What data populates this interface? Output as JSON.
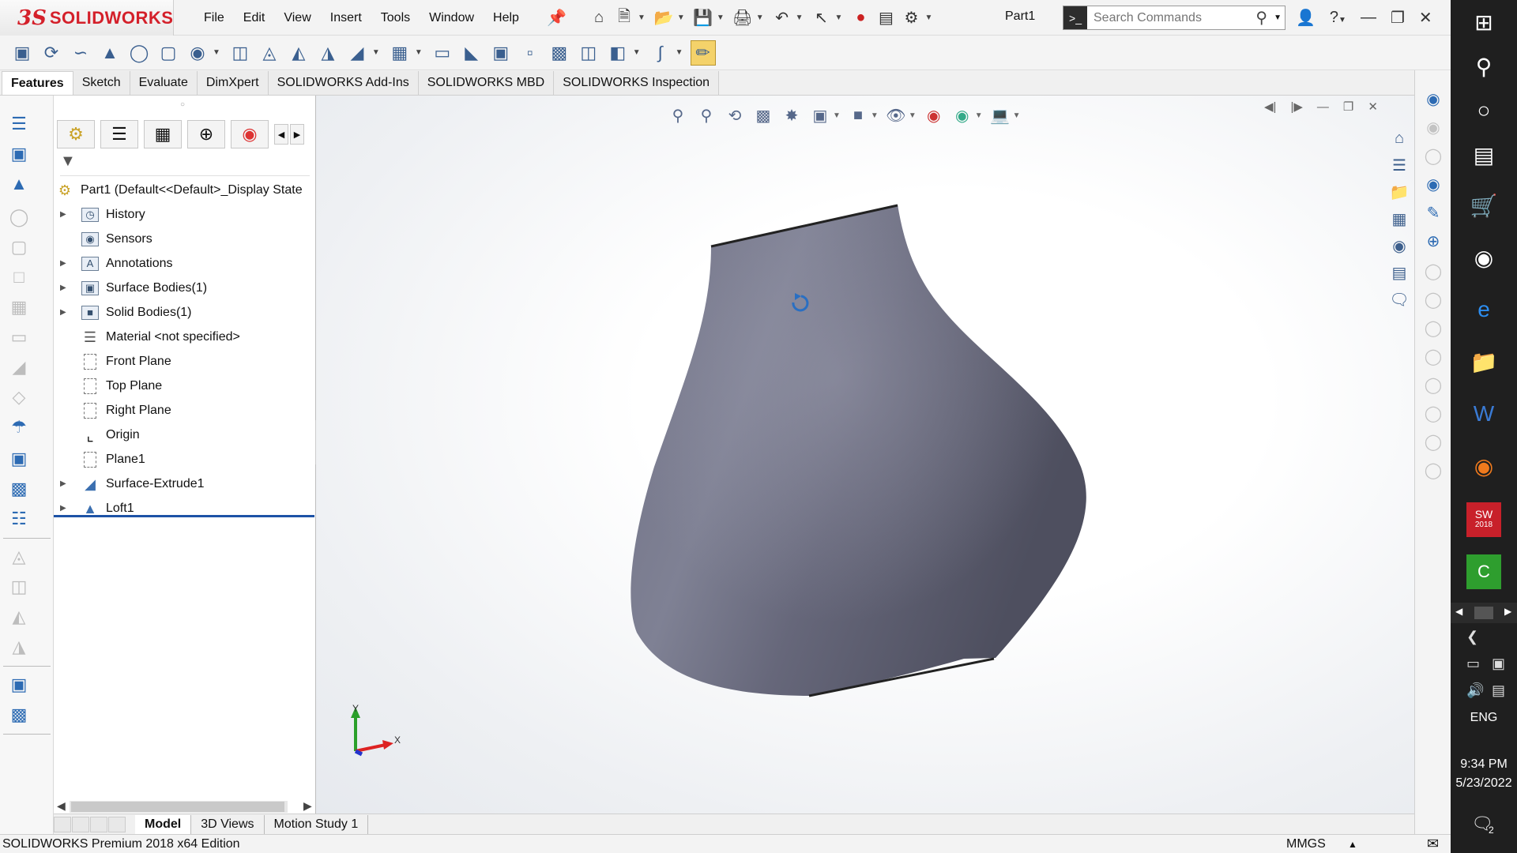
{
  "app": {
    "brand_prefix": "3S",
    "brand": "SOLIDWORKS",
    "document_title": "Part1",
    "menus": [
      "File",
      "Edit",
      "View",
      "Insert",
      "Tools",
      "Window",
      "Help"
    ],
    "search_placeholder": "Search Commands"
  },
  "tabs": [
    "Features",
    "Sketch",
    "Evaluate",
    "DimXpert",
    "SOLIDWORKS Add-Ins",
    "SOLIDWORKS MBD",
    "SOLIDWORKS Inspection"
  ],
  "active_tab": "Features",
  "feature_tree": {
    "root": "Part1  (Default<<Default>_Display State",
    "items": [
      {
        "label": "History",
        "expandable": true
      },
      {
        "label": "Sensors",
        "expandable": false
      },
      {
        "label": "Annotations",
        "expandable": true
      },
      {
        "label": "Surface Bodies(1)",
        "expandable": true
      },
      {
        "label": "Solid Bodies(1)",
        "expandable": true
      },
      {
        "label": "Material <not specified>",
        "expandable": false
      },
      {
        "label": "Front Plane",
        "expandable": false
      },
      {
        "label": "Top Plane",
        "expandable": false
      },
      {
        "label": "Right Plane",
        "expandable": false
      },
      {
        "label": "Origin",
        "expandable": false
      },
      {
        "label": "Plane1",
        "expandable": false
      },
      {
        "label": "Surface-Extrude1",
        "expandable": true
      },
      {
        "label": "Loft1",
        "expandable": true
      }
    ]
  },
  "bottom_tabs": [
    "Model",
    "3D Views",
    "Motion Study 1"
  ],
  "active_bottom_tab": "Model",
  "status": {
    "edition": "SOLIDWORKS Premium 2018 x64 Edition",
    "units": "MMGS"
  },
  "triad": {
    "y": "Y",
    "x": "X"
  },
  "taskbar": {
    "language": "ENG",
    "time": "9:34 PM",
    "date": "5/23/2022",
    "sw_badge": "2018",
    "notification_count": "2"
  },
  "colors": {
    "brand_red": "#d4202a",
    "model_surface": "#6e6f80",
    "rollback_bar": "#1d52a6",
    "active_toolbar": "#f4d26a"
  }
}
